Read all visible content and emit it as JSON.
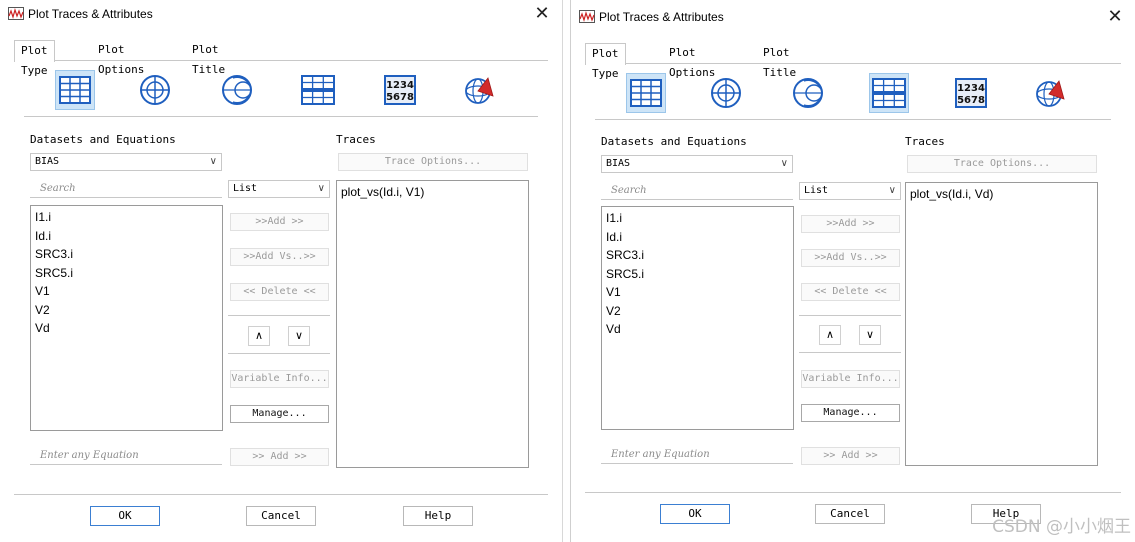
{
  "dialogs": [
    {
      "title": "Plot Traces & Attributes",
      "close_label": "✕",
      "tabs": [
        "Plot Type",
        "Plot Options",
        "Plot Title"
      ],
      "plot_types": [
        "rectangular-grid",
        "polar",
        "smith-chart",
        "stacked-rectangular",
        "list-1234-5678",
        "antenna-3d"
      ],
      "table_plot_text": [
        "1234",
        "5678"
      ],
      "datasets_label": "Datasets and Equations",
      "dataset_selected": "BIAS",
      "search_placeholder": "Search",
      "view_mode": "List",
      "variables": [
        "I1.i",
        "Id.i",
        "SRC3.i",
        "SRC5.i",
        "V1",
        "V2",
        "Vd"
      ],
      "buttons": {
        "add": ">>Add >>",
        "add_vs": ">>Add Vs..>>",
        "delete": "<< Delete <<",
        "up": "∧",
        "down": "∨",
        "variable_info": "Variable Info...",
        "manage": "Manage...",
        "add_equation": ">> Add >>"
      },
      "equation_placeholder": "Enter any Equation",
      "traces_label": "Traces",
      "trace_options": "Trace Options...",
      "traces": [
        "plot_vs(Id.i, V1)"
      ],
      "footer": {
        "ok": "OK",
        "cancel": "Cancel",
        "help": "Help"
      }
    },
    {
      "title": "Plot Traces & Attributes",
      "close_label": "✕",
      "tabs": [
        "Plot Type",
        "Plot Options",
        "Plot Title"
      ],
      "plot_types": [
        "rectangular-grid",
        "polar",
        "smith-chart",
        "stacked-rectangular",
        "list-1234-5678",
        "antenna-3d"
      ],
      "table_plot_text": [
        "1234",
        "5678"
      ],
      "datasets_label": "Datasets and Equations",
      "dataset_selected": "BIAS",
      "search_placeholder": "Search",
      "view_mode": "List",
      "variables": [
        "I1.i",
        "Id.i",
        "SRC3.i",
        "SRC5.i",
        "V1",
        "V2",
        "Vd"
      ],
      "buttons": {
        "add": ">>Add >>",
        "add_vs": ">>Add Vs..>>",
        "delete": "<< Delete <<",
        "up": "∧",
        "down": "∨",
        "variable_info": "Variable Info...",
        "manage": "Manage...",
        "add_equation": ">> Add >>"
      },
      "equation_placeholder": "Enter any Equation",
      "traces_label": "Traces",
      "trace_options": "Trace Options...",
      "traces": [
        "plot_vs(Id.i, Vd)"
      ],
      "footer": {
        "ok": "OK",
        "cancel": "Cancel",
        "help": "Help"
      }
    }
  ],
  "watermark": "CSDN @小小烟王",
  "colors": {
    "selected_icon_bg": "#cde4f7",
    "icon_blue": "#1f5fbf",
    "ok_border": "#3b7fd2",
    "app_icon_red": "#cc2222"
  }
}
